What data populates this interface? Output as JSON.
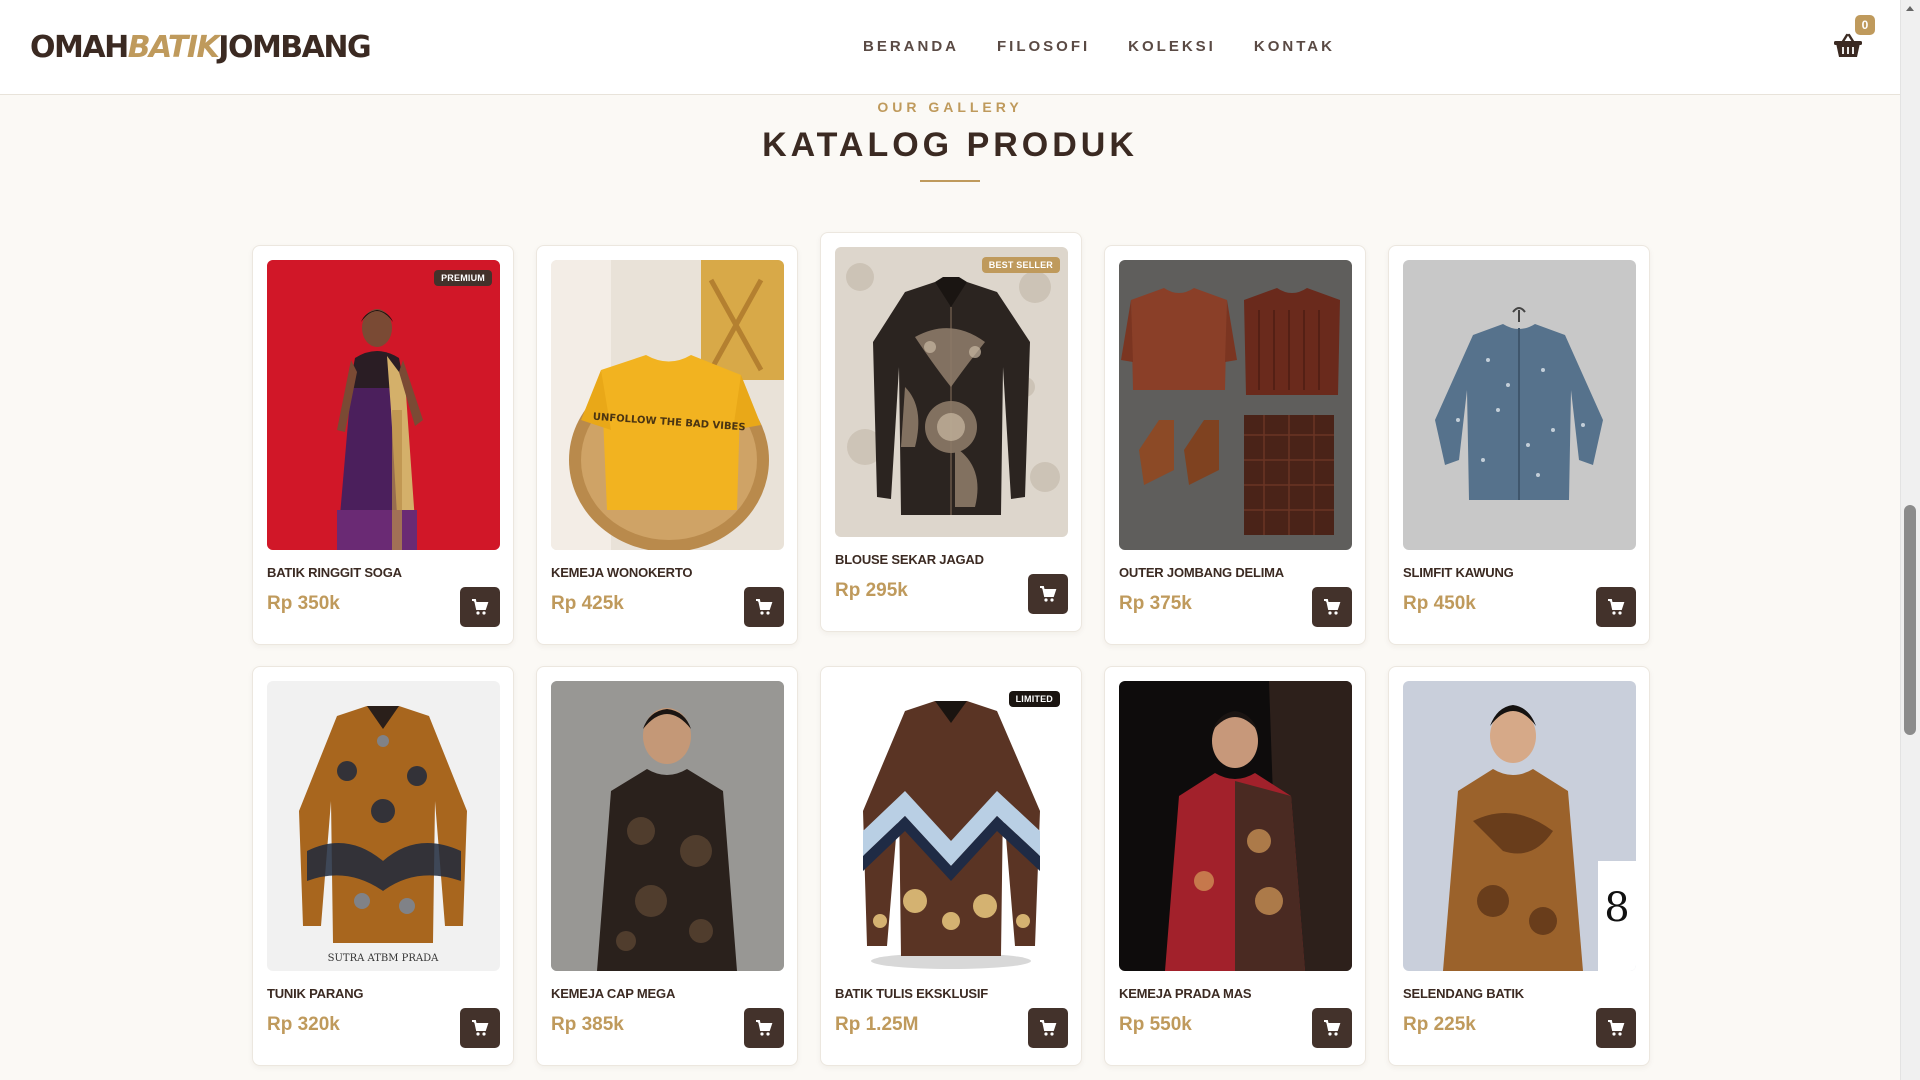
{
  "header": {
    "logo_part1": "OMAH",
    "logo_accent": "BATIK",
    "logo_part2": "JOMBANG",
    "nav": [
      "BERANDA",
      "FILOSOFI",
      "KOLEKSI",
      "KONTAK"
    ],
    "cart_icon": "basket-icon",
    "cart_count": "0"
  },
  "section": {
    "eyebrow": "OUR GALLERY",
    "title": "KATALOG PRODUK"
  },
  "colors": {
    "accent": "#bf9a5c",
    "dark": "#43322b",
    "background": "#fbf9f5"
  },
  "products": [
    {
      "name": "BATIK RINGGIT SOGA",
      "price": "Rp 350k",
      "badge": "PREMIUM"
    },
    {
      "name": "KEMEJA WONOKERTO",
      "price": "Rp 425k",
      "badge": ""
    },
    {
      "name": "BLOUSE SEKAR JAGAD",
      "price": "Rp 295k",
      "badge": "BEST SELLER"
    },
    {
      "name": "OUTER JOMBANG DELIMA",
      "price": "Rp 375k",
      "badge": ""
    },
    {
      "name": "SLIMFIT KAWUNG",
      "price": "Rp 450k",
      "badge": ""
    },
    {
      "name": "TUNIK PARANG",
      "price": "Rp 320k",
      "badge": ""
    },
    {
      "name": "KEMEJA CAP MEGA",
      "price": "Rp 385k",
      "badge": ""
    },
    {
      "name": "BATIK TULIS EKSKLUSIF",
      "price": "Rp 1.25M",
      "badge": "LIMITED"
    },
    {
      "name": "KEMEJA PRADA MAS",
      "price": "Rp 550k",
      "badge": ""
    },
    {
      "name": "SELENDANG BATIK",
      "price": "Rp 225k",
      "badge": ""
    }
  ],
  "photo_texts": {
    "tshirt_print": "UNFOLLOW THE BAD VIBES",
    "shirt_caption": "SUTRA ATBM PRADA"
  },
  "add_to_cart_icon": "cart-icon"
}
